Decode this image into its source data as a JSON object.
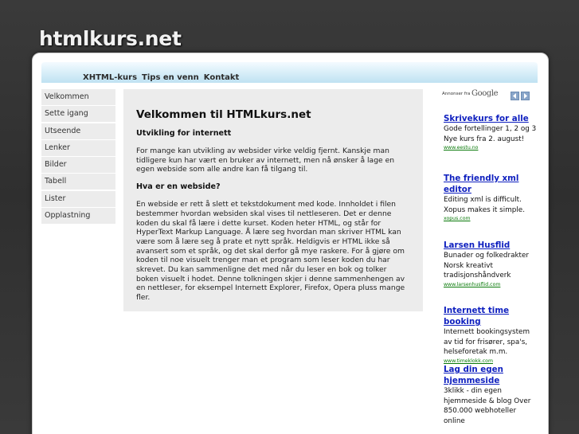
{
  "site": {
    "title": "htmlkurs.net"
  },
  "nav": [
    "XHTML-kurs",
    "Tips en venn",
    "Kontakt"
  ],
  "sidebar": [
    "Velkommen",
    "Sette igang",
    "Utseende",
    "Lenker",
    "Bilder",
    "Tabell",
    "Lister",
    "Opplastning"
  ],
  "content": {
    "heading": "Velkommen til HTMLkurs.net",
    "subheading1": "Utvikling for internett",
    "paragraph1": "For mange kan utvikling av websider virke veldig fjernt. Kanskje man tidligere kun har vært en bruker av internett, men nå ønsker å lage en egen webside som alle andre kan få tilgang til.",
    "subheading2": "Hva er en webside?",
    "paragraph2": "En webside er rett å slett et tekstdokument med kode. Innholdet i filen bestemmer hvordan websiden skal vises til nettleseren. Det er denne koden du skal få lære i dette kurset. Koden heter HTML, og står for HyperText Markup Language. Å lære seg hvordan man skriver HTML kan være som å lære seg å prate et nytt språk. Heldigvis er HTML ikke så avansert som et språk, og det skal derfor gå mye raskere. For å gjøre om koden til noe visuelt trenger man et program som leser koden du har skrevet. Du kan sammenligne det med når du leser en bok og tolker boken visuelt i hodet. Denne tolkningen skjer i denne sammenhengen av en nettleser, for eksempel Internett Explorer, Firefox, Opera pluss mange fler."
  },
  "ads": {
    "label": "Annonser fra",
    "brand": "Google",
    "items": [
      {
        "title_lines": [
          "Skrivekurs for alle"
        ],
        "text_lines": [
          "Gode fortellinger 1, 2 og 3",
          "Nye kurs fra 2. august!"
        ],
        "url": "www.eestu.no"
      },
      {
        "title_lines": [
          "The friendly xml",
          "editor"
        ],
        "text_lines": [
          "Editing xml is difficult.",
          "Xopus makes it simple."
        ],
        "url": "xopus.com"
      },
      {
        "title_lines": [
          "Larsen Husflid"
        ],
        "text_lines": [
          "Bunader og folkedrakter",
          "Norsk kreativt",
          "tradisjonshåndverk"
        ],
        "url": "www.larsenhusflid.com"
      },
      {
        "title_lines": [
          "Internett time booking"
        ],
        "text_lines": [
          "Internett bookingsystem",
          "av tid for frisører, spa's,",
          "helseforetak m.m."
        ],
        "url": "www.timeklokk.com"
      },
      {
        "title_lines": [
          "Lag din egen",
          "hjemmeside"
        ],
        "text_lines": [
          "3klikk - din egen",
          "hjemmeside & blog Over",
          "850.000 webhoteller",
          "online"
        ],
        "url": ""
      }
    ]
  },
  "colors": {
    "background": "#333333",
    "nav_gradient": "#bfe2f2",
    "content_bg": "#ececec",
    "ad_link": "#0e1fbf",
    "ad_url": "#0a7a0a"
  }
}
